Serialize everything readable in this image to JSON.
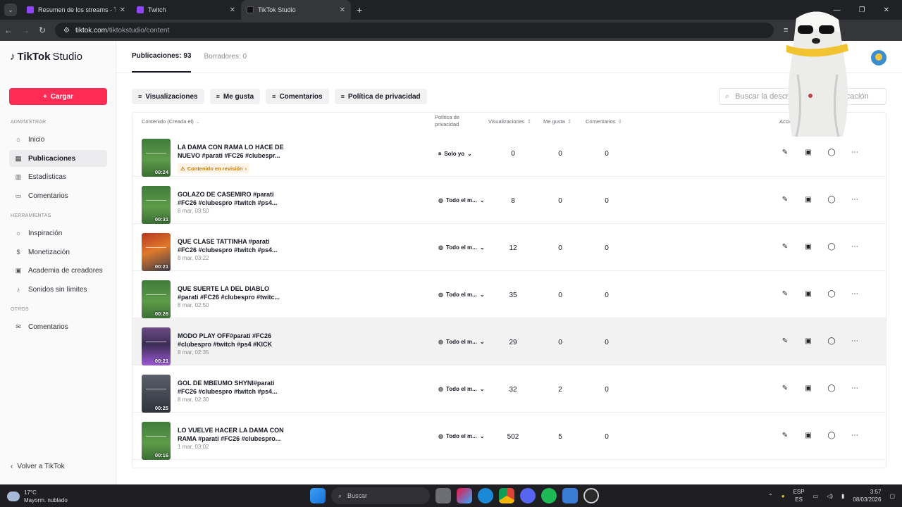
{
  "browser": {
    "tabs": [
      {
        "title": "Resumen de los streams - Twitc",
        "active": false
      },
      {
        "title": "Twitch",
        "active": false
      },
      {
        "title": "TikTok Studio",
        "active": true
      }
    ],
    "url_domain": "tiktok.com",
    "url_path": "/tiktokstudio/content"
  },
  "sidebar": {
    "logo": "TikTok",
    "logo_suffix": "Studio",
    "upload_label": "Cargar",
    "section_admin": "ADMINISTRAR",
    "admin_items": [
      {
        "label": "Inicio",
        "icon": "home-icon"
      },
      {
        "label": "Publicaciones",
        "icon": "posts-icon",
        "active": true
      },
      {
        "label": "Estadísticas",
        "icon": "analytics-icon"
      },
      {
        "label": "Comentarios",
        "icon": "comments-icon"
      }
    ],
    "section_tools": "HERRAMIENTAS",
    "tool_items": [
      {
        "label": "Inspiración",
        "icon": "lightbulb-icon"
      },
      {
        "label": "Monetización",
        "icon": "dollar-icon"
      },
      {
        "label": "Academia de creadores",
        "icon": "academy-icon"
      },
      {
        "label": "Sonidos sin límites",
        "icon": "music-icon"
      }
    ],
    "section_others": "OTROS",
    "other_items": [
      {
        "label": "Comentarios",
        "icon": "mail-icon"
      }
    ],
    "back_label": "Volver a TikTok"
  },
  "content": {
    "tab_posts": "Publicaciones: 93",
    "tab_drafts": "Borradores: 0",
    "filters": [
      "Visualizaciones",
      "Me gusta",
      "Comentarios",
      "Política de privacidad"
    ],
    "search_placeholder": "Buscar la descripción de la publicación",
    "columns": {
      "content": "Contenido (Creada el)",
      "privacy": "Política de privacidad",
      "views": "Visualizaciones",
      "likes": "Me gusta",
      "comments": "Comentarios",
      "actions": "Acciones"
    },
    "rows": [
      {
        "title": "LA DAMA CON RAMA LO HACE DE NUEVO #parati #FC26 #clubespr...",
        "date": "",
        "review": "Contenido en revisión",
        "privacy": "Solo yo",
        "privacy_icon": "lock-icon",
        "views": "0",
        "likes": "0",
        "comments": "0",
        "duration": "00:24",
        "thumb": "green"
      },
      {
        "title": "GOLAZO DE CASEMIRO #parati #FC26 #clubespro #twitch #ps4...",
        "date": "8 mar, 03:50",
        "privacy": "Todo el m...",
        "privacy_icon": "globe-icon",
        "views": "8",
        "likes": "0",
        "comments": "0",
        "duration": "00:31",
        "thumb": "green"
      },
      {
        "title": "QUE CLASE TATTINHA #parati #FC26 #clubespro #twitch #ps4...",
        "date": "8 mar, 03:22",
        "privacy": "Todo el m...",
        "privacy_icon": "globe-icon",
        "views": "12",
        "likes": "0",
        "comments": "0",
        "duration": "00:21",
        "thumb": "red"
      },
      {
        "title": "QUE SUERTE LA DEL DIABLO #parati #FC26 #clubespro #twitc...",
        "date": "8 mar, 02:50",
        "privacy": "Todo el m...",
        "privacy_icon": "globe-icon",
        "views": "35",
        "likes": "0",
        "comments": "0",
        "duration": "00:26",
        "thumb": "green"
      },
      {
        "title": "MODO PLAY OFF#parati #FC26 #clubespro #twitch #ps4 #KICK",
        "date": "8 mar, 02:35",
        "privacy": "Todo el m...",
        "privacy_icon": "globe-icon",
        "views": "29",
        "likes": "0",
        "comments": "0",
        "duration": "00:21",
        "thumb": "purple"
      },
      {
        "title": "GOL DE MBEUMO SHYNI#parati #FC26 #clubespro #twitch #ps4...",
        "date": "8 mar, 02:30",
        "privacy": "Todo el m...",
        "privacy_icon": "globe-icon",
        "views": "32",
        "likes": "2",
        "comments": "0",
        "duration": "00:25",
        "thumb": "dark"
      },
      {
        "title": "LO VUELVE HACER LA DAMA CON RAMA #parati #FC26 #clubespro...",
        "date": "1 mar, 03:02",
        "privacy": "Todo el m...",
        "privacy_icon": "globe-icon",
        "views": "502",
        "likes": "5",
        "comments": "0",
        "duration": "00:16",
        "thumb": "green"
      }
    ]
  },
  "taskbar": {
    "temperature": "17°C",
    "weather": "Mayorm. nublado",
    "search_label": "Buscar",
    "lang_top": "ESP",
    "lang_bottom": "ES",
    "time": "3:57",
    "date": "08/03/2026"
  }
}
